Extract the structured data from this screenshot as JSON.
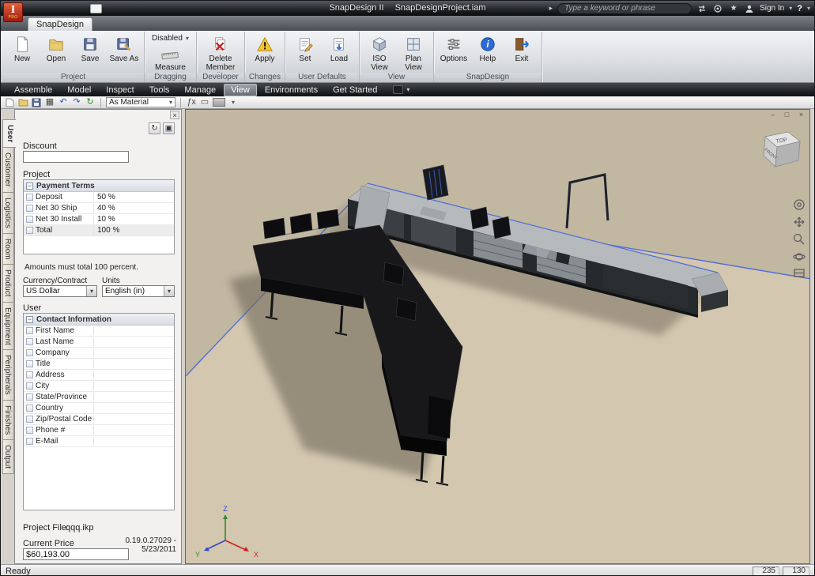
{
  "window": {
    "app_title": "SnapDesign II",
    "doc_title": "SnapDesignProject.iam",
    "search_placeholder": "Type a keyword or phrase",
    "sign_in_label": "Sign In",
    "help_label": "?"
  },
  "ribbon": {
    "tab_label": "SnapDesign",
    "groups": [
      {
        "label": "Project",
        "buttons": [
          "New",
          "Open",
          "Save",
          "Save As"
        ]
      },
      {
        "label": "Dragging",
        "buttons": [
          "Disabled",
          "Measure"
        ]
      },
      {
        "label": "Developer",
        "buttons": [
          "Delete Member Files"
        ]
      },
      {
        "label": "Changes",
        "buttons": [
          "Apply"
        ]
      },
      {
        "label": "User Defaults",
        "buttons": [
          "Set",
          "Load"
        ]
      },
      {
        "label": "View",
        "buttons": [
          "ISO View",
          "Plan View"
        ]
      },
      {
        "label": "SnapDesign",
        "buttons": [
          "Options",
          "Help",
          "Exit"
        ]
      }
    ]
  },
  "menubar": {
    "items": [
      "Assemble",
      "Model",
      "Inspect",
      "Tools",
      "Manage",
      "View",
      "Environments",
      "Get Started"
    ]
  },
  "toolbar": {
    "material_value": "As Material"
  },
  "side_tabs": [
    "User",
    "Customer",
    "Logistics",
    "Room",
    "Product",
    "Equipment",
    "Peripherals",
    "Finishes",
    "Output"
  ],
  "panel": {
    "discount_label": "Discount",
    "discount_value": "",
    "project_label": "Project",
    "payment": {
      "header": "Payment Terms",
      "rows": [
        {
          "label": "Deposit",
          "value": "50 %"
        },
        {
          "label": "Net 30 Ship",
          "value": "40 %"
        },
        {
          "label": "Net 30 Install",
          "value": "10 %"
        },
        {
          "label": "Total",
          "value": "100 %"
        }
      ]
    },
    "note": "Amounts must total 100 percent.",
    "currency_label": "Currency/Contract",
    "currency_value": "US Dollar",
    "units_label": "Units",
    "units_value": "English (in)",
    "user_label": "User",
    "contact": {
      "header": "Contact Information",
      "rows": [
        "First Name",
        "Last Name",
        "Company",
        "Title",
        "Address",
        "City",
        "State/Province",
        "Country",
        "Zip/Postal Code",
        "Phone #",
        "E-Mail"
      ]
    },
    "project_file_label": "Project File:",
    "project_file_value": "qqq.ikp",
    "current_price_label": "Current Price",
    "current_price_value": "$60,193.00",
    "version_line1": "0.19.0.27029 -",
    "version_line2": "5/23/2011"
  },
  "viewport": {
    "viewcube_top": "TOP",
    "viewcube_front": "FRONT",
    "axis_x": "X",
    "axis_y": "Y",
    "axis_z": "Z"
  },
  "statusbar": {
    "ready": "Ready",
    "cells": [
      "235",
      "130"
    ]
  },
  "colors": {
    "accent_blue": "#4f6fd8",
    "floor_tan": "#d3c7af",
    "backdrop_tan": "#c2b7a1"
  }
}
